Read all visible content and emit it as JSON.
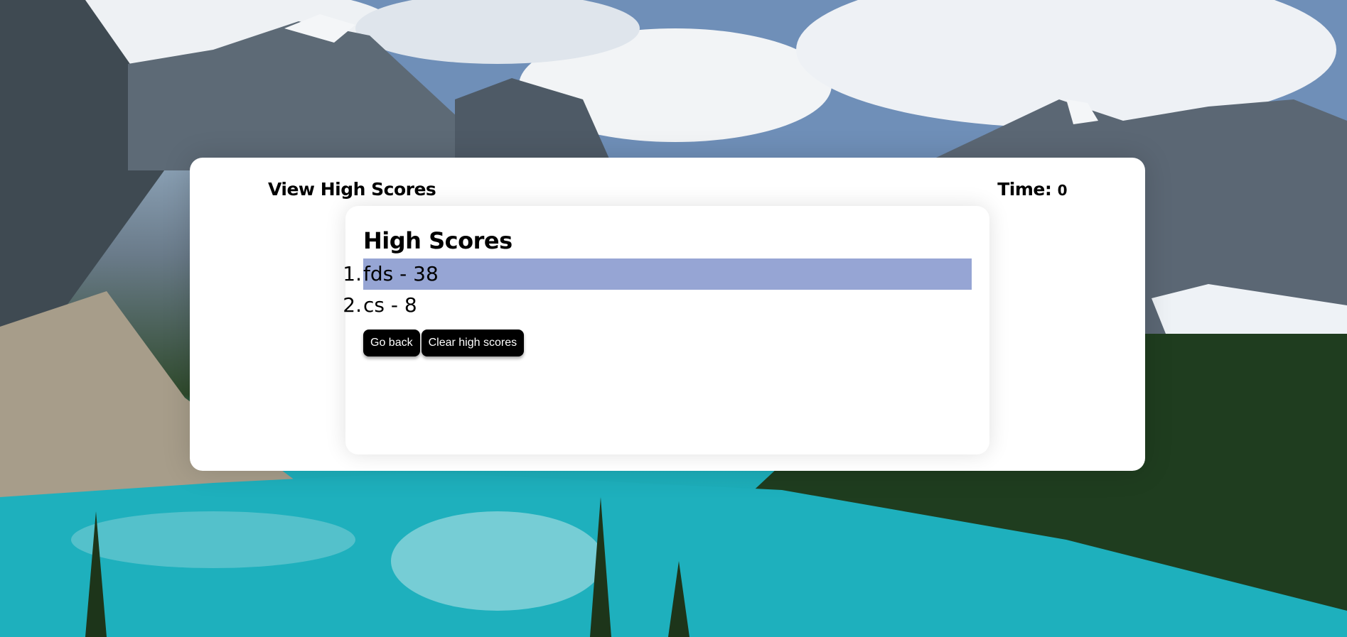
{
  "header": {
    "view_high_scores": "View High Scores",
    "time_label": "Time: ",
    "time_value": "0"
  },
  "panel": {
    "title": "High Scores",
    "scores": [
      {
        "rank": "1.",
        "text": "fds - 38"
      },
      {
        "rank": "2.",
        "text": "cs - 8"
      }
    ],
    "go_back_label": "Go back",
    "clear_label": "Clear high scores"
  },
  "colors": {
    "highlight": "#96a5d4",
    "button_bg": "#000000",
    "card_bg": "#ffffff"
  },
  "background": {
    "description_icon": "mountain-lake-photo"
  }
}
